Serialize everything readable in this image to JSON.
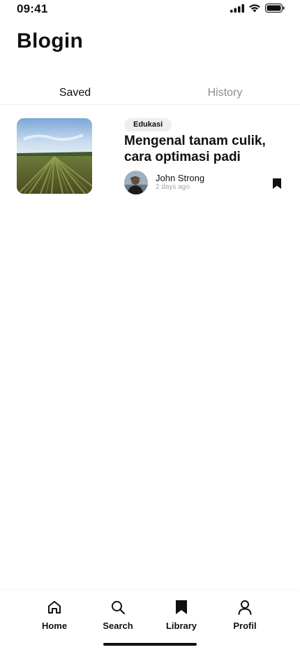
{
  "status_bar": {
    "time": "09:41"
  },
  "app": {
    "title": "Blogin"
  },
  "tabs": [
    {
      "label": "Saved",
      "active": true
    },
    {
      "label": "History",
      "active": false
    }
  ],
  "saved_posts": [
    {
      "category": "Edukasi",
      "title": "Mengenal tanam culik, cara optimasi padi",
      "author": "John Strong",
      "time_ago": "2 days ago",
      "bookmarked": true
    }
  ],
  "bottom_nav": [
    {
      "label": "Home",
      "icon": "home-icon"
    },
    {
      "label": "Search",
      "icon": "search-icon"
    },
    {
      "label": "Library",
      "icon": "bookmark-icon"
    },
    {
      "label": "Profil",
      "icon": "user-icon"
    }
  ],
  "colors": {
    "text": "#111111",
    "muted": "#8d8d8d",
    "badge_bg": "#eeeeee"
  }
}
